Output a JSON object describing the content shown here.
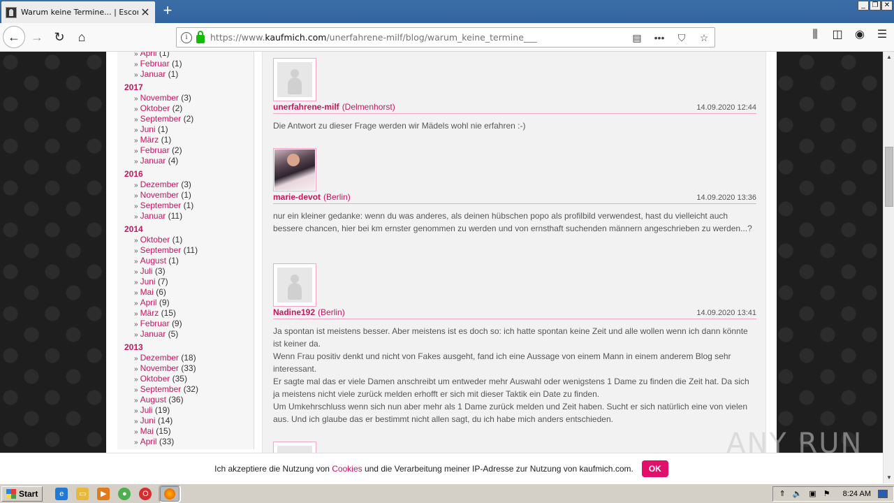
{
  "browser": {
    "tab_title": "Warum keine Termine... | Escort u",
    "tab_close": "✕",
    "new_tab": "+",
    "url_prefix": "https://www.",
    "url_domain": "kaufmich.com",
    "url_path": "/unerfahrene-milf/blog/warum_keine_termine___",
    "window_min": "_",
    "window_max": "❐",
    "window_close": "✕"
  },
  "sidebar": {
    "archive": [
      {
        "year": null,
        "months": [
          {
            "name": "April",
            "count": "(1)"
          },
          {
            "name": "Februar",
            "count": "(1)"
          },
          {
            "name": "Januar",
            "count": "(1)"
          }
        ]
      },
      {
        "year": "2017",
        "months": [
          {
            "name": "November",
            "count": "(3)"
          },
          {
            "name": "Oktober",
            "count": "(2)"
          },
          {
            "name": "September",
            "count": "(2)"
          },
          {
            "name": "Juni",
            "count": "(1)"
          },
          {
            "name": "März",
            "count": "(1)"
          },
          {
            "name": "Februar",
            "count": "(2)"
          },
          {
            "name": "Januar",
            "count": "(4)"
          }
        ]
      },
      {
        "year": "2016",
        "months": [
          {
            "name": "Dezember",
            "count": "(3)"
          },
          {
            "name": "November",
            "count": "(1)"
          },
          {
            "name": "September",
            "count": "(1)"
          },
          {
            "name": "Januar",
            "count": "(11)"
          }
        ]
      },
      {
        "year": "2014",
        "months": [
          {
            "name": "Oktober",
            "count": "(1)"
          },
          {
            "name": "September",
            "count": "(11)"
          },
          {
            "name": "August",
            "count": "(1)"
          },
          {
            "name": "Juli",
            "count": "(3)"
          },
          {
            "name": "Juni",
            "count": "(7)"
          },
          {
            "name": "Mai",
            "count": "(6)"
          },
          {
            "name": "April",
            "count": "(9)"
          },
          {
            "name": "März",
            "count": "(15)"
          },
          {
            "name": "Februar",
            "count": "(9)"
          },
          {
            "name": "Januar",
            "count": "(5)"
          }
        ]
      },
      {
        "year": "2013",
        "months": [
          {
            "name": "Dezember",
            "count": "(18)"
          },
          {
            "name": "November",
            "count": "(33)"
          },
          {
            "name": "Oktober",
            "count": "(35)"
          },
          {
            "name": "September",
            "count": "(32)"
          },
          {
            "name": "August",
            "count": "(36)"
          },
          {
            "name": "Juli",
            "count": "(19)"
          },
          {
            "name": "Juni",
            "count": "(14)"
          },
          {
            "name": "Mai",
            "count": "(15)"
          },
          {
            "name": "April",
            "count": "(33)"
          }
        ]
      }
    ]
  },
  "comments": [
    {
      "user": "unerfahrene-milf",
      "city": "(Delmenhorst)",
      "date": "14.09.2020 12:44",
      "avatar": "placeholder",
      "text": [
        "Die Antwort zu dieser Frage werden wir Mädels wohl nie erfahren :-)"
      ]
    },
    {
      "user": "marie-devot",
      "city": "(Berlin)",
      "date": "14.09.2020 13:36",
      "avatar": "photo",
      "text": [
        "nur ein kleiner gedanke: wenn du was anderes, als deinen hübschen popo als profilbild verwendest, hast du vielleicht auch bessere chancen, hier bei km ernster genommen zu werden und von ernsthaft suchenden männern angeschrieben zu werden...?"
      ]
    },
    {
      "user": "Nadine192",
      "city": "(Berlin)",
      "date": "14.09.2020 13:41",
      "avatar": "placeholder",
      "text": [
        "Ja spontan ist meistens besser. Aber meistens ist es doch so: ich hatte spontan keine Zeit und alle wollen wenn ich dann könnte ist keiner da.",
        "Wenn Frau positiv denkt und nicht von Fakes ausgeht, fand ich eine Aussage von einem Mann in einem anderem Blog sehr interessant.",
        "Er sagte mal das er viele Damen anschreibt um entweder mehr Auswahl oder wenigstens 1 Dame zu finden die Zeit hat. Da sich ja meistens nicht viele zurück melden erhofft er sich mit dieser Taktik ein Date zu finden.",
        "Um Umkehrschluss wenn sich nun aber mehr als 1 Dame zurück melden und Zeit haben. Sucht er sich natürlich eine von vielen aus. Und ich glaube das er bestimmt nicht allen sagt, du ich habe mich anders entschieden."
      ]
    }
  ],
  "cookie": {
    "before": "Ich akzeptiere die Nutzung von ",
    "link": "Cookies",
    "after": " und die Verarbeitung meiner IP-Adresse zur Nutzung von kaufmich.com.",
    "ok": "OK"
  },
  "watermark": "ANY RUN",
  "taskbar": {
    "start": "Start",
    "clock": "8:24 AM"
  },
  "icons": [
    "back-arrow-icon",
    "forward-arrow-icon",
    "reload-icon",
    "home-icon",
    "info-icon",
    "lock-icon",
    "reader-icon",
    "more-icon",
    "pocket-icon",
    "star-icon",
    "library-icon",
    "sidebar-icon",
    "account-icon",
    "menu-icon"
  ]
}
